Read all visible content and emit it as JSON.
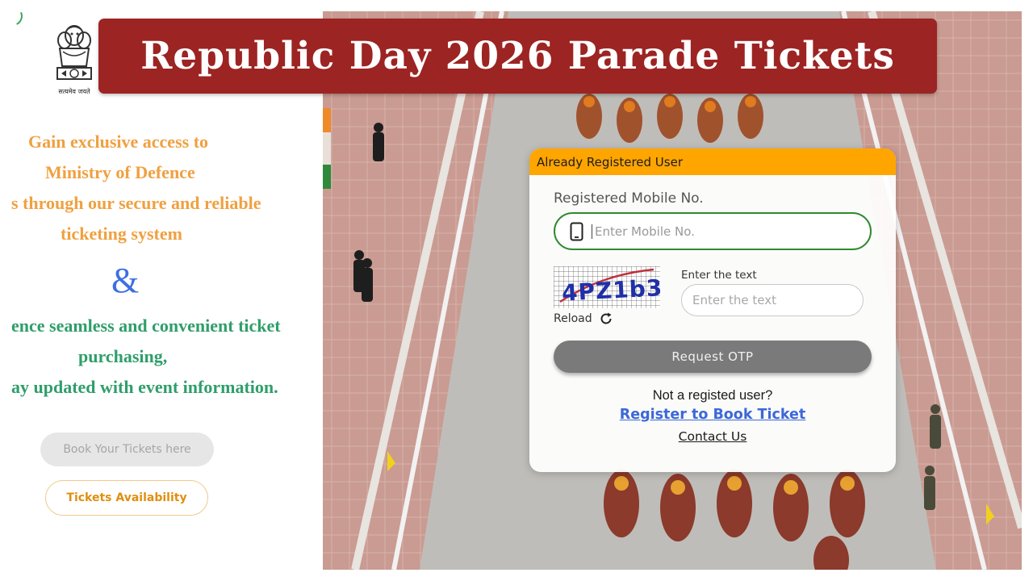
{
  "left": {
    "emblem_motto": "सत्यमेव जयते",
    "promo_lines_orange": [
      "Gain exclusive access to",
      "Ministry of Defence",
      "s through our secure and reliable",
      "ticketing system"
    ],
    "ampersand": "&",
    "promo_lines_green": [
      "ence seamless and convenient ticket",
      "purchasing,",
      "ay updated with event information."
    ],
    "book_button": "Book Your Tickets here",
    "availability_button": "Tickets Availability"
  },
  "banner": {
    "title": "Republic Day 2026 Parade Tickets"
  },
  "login": {
    "header": "Already Registered User",
    "mobile_label": "Registered Mobile No.",
    "mobile_placeholder": "Enter Mobile No.",
    "captcha_text": "4PZ1b3",
    "reload_label": "Reload",
    "captcha_label": "Enter the text",
    "captcha_placeholder": "Enter the text",
    "otp_button": "Request OTP",
    "not_registered": "Not a registed user?",
    "register_link": "Register to Book Ticket",
    "contact_link": "Contact Us"
  },
  "colors": {
    "banner": "#9c2423",
    "card_header": "#ffa500",
    "promo_orange": "#f0a040",
    "promo_green": "#2f9e6a",
    "link_blue": "#3d68d8",
    "mobile_border": "#2e8a2e"
  }
}
